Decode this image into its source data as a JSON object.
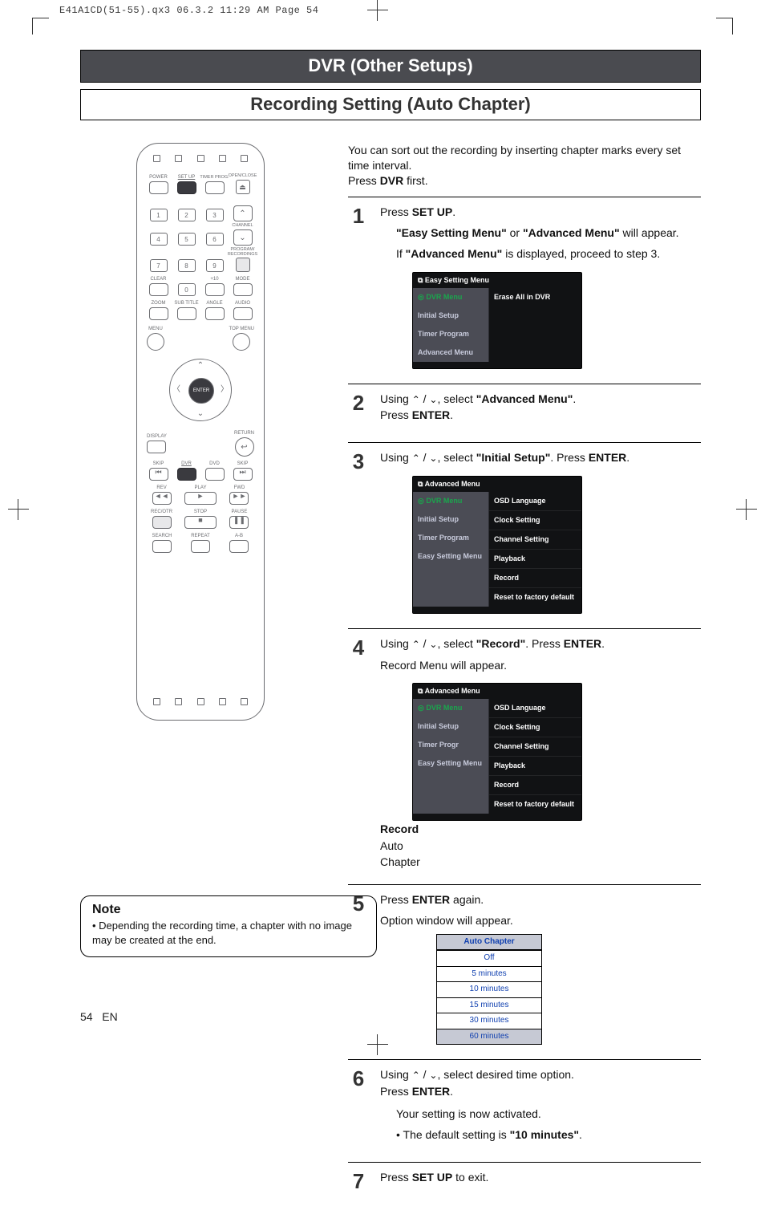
{
  "print_header": "E41A1CD(51-55).qx3  06.3.2 11:29 AM  Page 54",
  "page_number": "54",
  "page_lang": "EN",
  "titles": {
    "section": "DVR (Other Setups)",
    "subsection": "Recording Setting (Auto Chapter)"
  },
  "intro": {
    "line1": "You can sort out the recording by inserting chapter marks every set time interval.",
    "line2_pre": "Press ",
    "line2_bold": "DVR",
    "line2_post": " first."
  },
  "remote": {
    "top_row_labels": [
      "POWER",
      "SET UP",
      "TIMER PROG.",
      "OPEN/CLOSE"
    ],
    "nums": [
      "1",
      "2",
      "3",
      "4",
      "5",
      "6",
      "7",
      "8",
      "9",
      "0"
    ],
    "channel": "CHANNEL",
    "prog_rec": "PROGRAM/\nRECORDINGS",
    "clear": "CLEAR",
    "plus10": "+10",
    "mode": "MODE",
    "row_av": [
      "ZOOM",
      "SUB TITLE",
      "ANGLE",
      "AUDIO"
    ],
    "menu": "MENU",
    "topmenu": "TOP MENU",
    "enter": "ENTER",
    "display": "DISPLAY",
    "return": "RETURN",
    "row_media": [
      "SKIP",
      "DVR",
      "DVD",
      "SKIP"
    ],
    "row_trans": [
      "REV",
      "PLAY",
      "FWD"
    ],
    "row_trans2": [
      "REC/OTR",
      "STOP",
      "PAUSE"
    ],
    "row_bottom": [
      "SEARCH",
      "REPEAT",
      "A-B"
    ]
  },
  "steps": [
    {
      "n": "1",
      "text_parts": [
        "Press ",
        "SET UP",
        "."
      ],
      "sub1_parts": [
        "\"Easy Setting Menu\"",
        " or ",
        "\"Advanced Menu\"",
        " will appear."
      ],
      "sub2_parts": [
        "If ",
        "\"Advanced Menu\"",
        " is displayed, proceed to step 3."
      ],
      "osd": {
        "header": "Easy Setting Menu",
        "left": [
          "DVR Menu",
          "Initial Setup",
          "Timer Program",
          "Advanced Menu"
        ],
        "left_active_index": 0,
        "right": [
          "Erase All in DVR"
        ]
      }
    },
    {
      "n": "2",
      "text_parts": [
        "Using ",
        " / ",
        ", select ",
        "\"Advanced Menu\"",
        ".",
        "\nPress ",
        "ENTER",
        "."
      ]
    },
    {
      "n": "3",
      "text_parts": [
        "Using ",
        " / ",
        ", select ",
        "\"Initial Setup\"",
        ". Press ",
        "ENTER",
        "."
      ],
      "osd": {
        "header": "Advanced Menu",
        "left": [
          "DVR Menu",
          "Initial Setup",
          "Timer Program",
          "Easy Setting Menu"
        ],
        "left_active_index": 0,
        "right": [
          "OSD Language",
          "Clock Setting",
          "Channel Setting",
          "Playback",
          "Record",
          "Reset to factory default"
        ]
      }
    },
    {
      "n": "4",
      "text_parts": [
        "Using ",
        " / ",
        ", select ",
        "\"Record\"",
        ".  Press ",
        "ENTER",
        "."
      ],
      "after": "Record Menu will appear.",
      "osd": {
        "header": "Advanced Menu",
        "left": [
          "DVR Menu",
          "Initial Setup",
          "Timer Progr",
          "Easy Setting Menu"
        ],
        "left_active_index": 0,
        "right": [
          "OSD Language",
          "Clock Setting",
          "Channel Setting",
          "Playback",
          "Record",
          "Reset to factory default"
        ],
        "popup": {
          "title": "Record",
          "item": "Auto Chapter"
        }
      }
    },
    {
      "n": "5",
      "text_parts": [
        "Press ",
        "ENTER",
        " again."
      ],
      "after": "Option window will appear.",
      "options": {
        "header": "Auto Chapter",
        "rows": [
          "Off",
          "5 minutes",
          "10 minutes",
          "15 minutes",
          "30 minutes",
          "60 minutes"
        ]
      }
    },
    {
      "n": "6",
      "text_parts": [
        "Using ",
        " / ",
        ", select desired time option.",
        "\nPress ",
        "ENTER",
        "."
      ],
      "sub_text": "Your setting is now activated.",
      "bullet_parts": [
        "• The default setting is ",
        "\"10 minutes\"",
        "."
      ]
    },
    {
      "n": "7",
      "text_parts": [
        "Press ",
        "SET UP",
        " to exit."
      ]
    }
  ],
  "note": {
    "heading": "Note",
    "text": "• Depending the recording time, a chapter with no image may be created at the end."
  }
}
